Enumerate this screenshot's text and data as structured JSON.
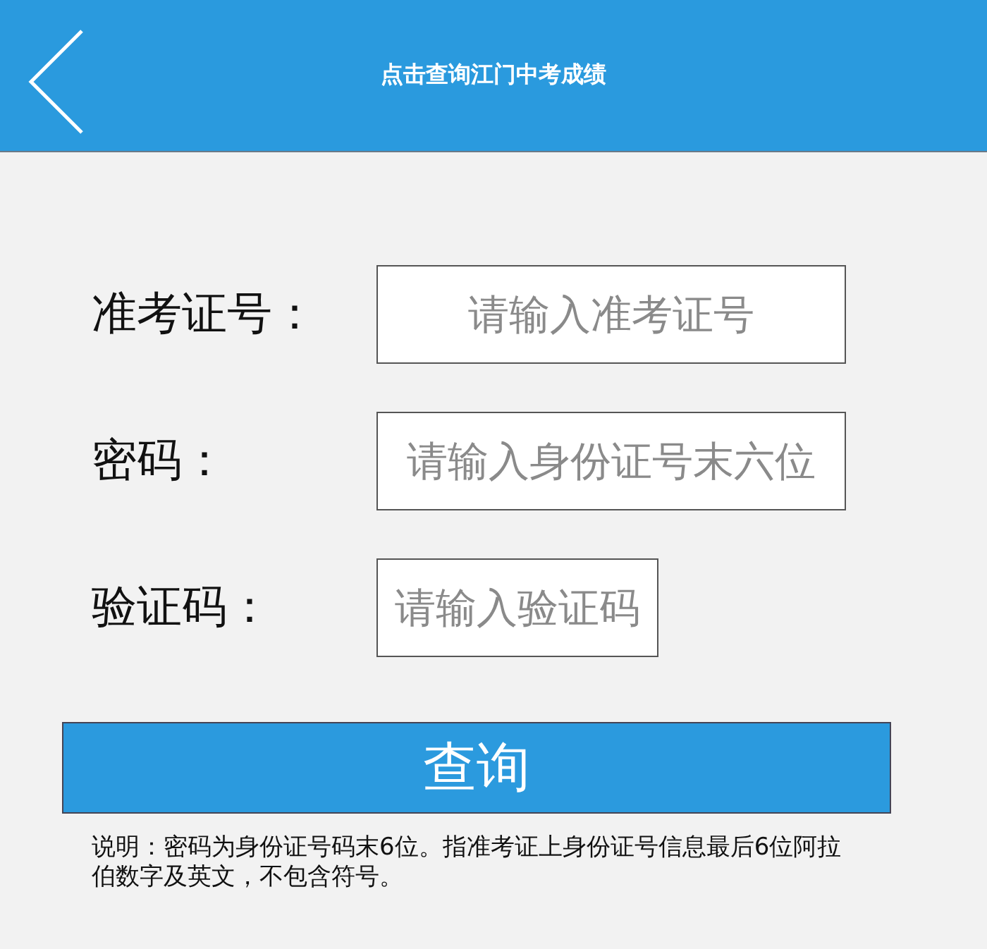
{
  "header": {
    "title": "点击查询江门中考成绩"
  },
  "fields": [
    {
      "label": "准考证号：",
      "placeholder": "请输入准考证号",
      "kind": "wide"
    },
    {
      "label": "密码：",
      "placeholder": "请输入身份证号末六位",
      "kind": "wide"
    },
    {
      "label": "验证码：",
      "placeholder": "请输入验证码",
      "kind": "narrow"
    }
  ],
  "submit": {
    "label": "查询"
  },
  "note": "说明：密码为身份证号码末6位。指准考证上身份证号信息最后6位阿拉伯数字及英文，不包含符号。"
}
